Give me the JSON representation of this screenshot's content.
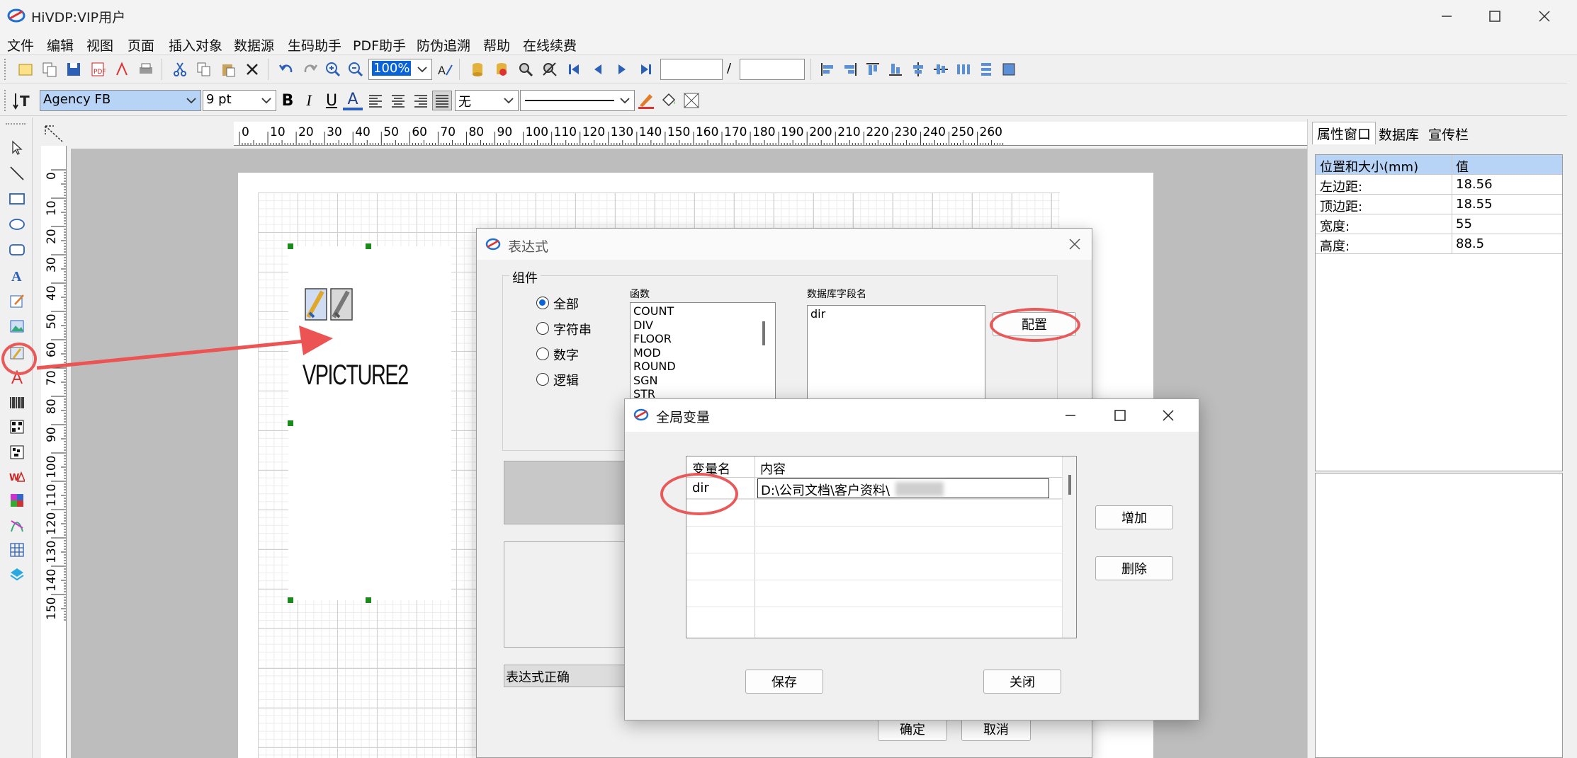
{
  "window": {
    "title": "HiVDP:VIP用户"
  },
  "menu": [
    "文件",
    "编辑",
    "视图",
    "页面",
    "插入对象",
    "数据源",
    "生码助手",
    "PDF助手",
    "防伪追溯",
    "帮助",
    "在线续费"
  ],
  "toolbar": {
    "zoom": "100%",
    "page_sep": "/"
  },
  "format_toolbar": {
    "font_name": "Agency FB",
    "font_size": "9 pt",
    "bold": "B",
    "italic": "I",
    "underline": "U",
    "font_color": "A",
    "border_style": "无"
  },
  "ruler": {
    "top": [
      "0",
      "10",
      "20",
      "30",
      "40",
      "50",
      "60",
      "70",
      "80",
      "90",
      "100",
      "110",
      "120",
      "130",
      "140",
      "150",
      "160",
      "170",
      "180",
      "190",
      "200",
      "210",
      "220",
      "230",
      "240",
      "250",
      "260"
    ],
    "left": [
      "0",
      "10",
      "20",
      "30",
      "40",
      "50",
      "60",
      "70",
      "80",
      "90",
      "100",
      "110",
      "120",
      "130",
      "140",
      "150"
    ]
  },
  "canvas": {
    "picture_label": "VPICTURE2"
  },
  "properties": {
    "tabs": [
      "属性窗口",
      "数据库",
      "宣传栏"
    ],
    "header_key": "位置和大小(mm)",
    "header_value": "值",
    "rows": [
      {
        "key": "左边距:",
        "value": "18.56"
      },
      {
        "key": "顶边距:",
        "value": "18.55"
      },
      {
        "key": "宽度:",
        "value": "55"
      },
      {
        "key": "高度:",
        "value": "88.5"
      }
    ]
  },
  "expression_dialog": {
    "title": "表达式",
    "group_label": "组件",
    "radio_options": [
      "全部",
      "字符串",
      "数字",
      "逻辑"
    ],
    "selected_radio": "全部",
    "functions_label": "函数",
    "functions": [
      "COUNT",
      "DIV",
      "FLOOR",
      "MOD",
      "ROUND",
      "SGN",
      "STR"
    ],
    "db_fields_label": "数据库字段名",
    "db_fields": [
      "dir"
    ],
    "config_button": "配置",
    "status": "表达式正确",
    "ok_button": "确定",
    "cancel_button": "取消"
  },
  "global_var_dialog": {
    "title": "全局变量",
    "col_name": "变量名",
    "col_content": "内容",
    "rows": [
      {
        "name": "dir",
        "content": "D:\\公司文档\\客户资料\\"
      }
    ],
    "add_button": "增加",
    "delete_button": "删除",
    "save_button": "保存",
    "close_button": "关闭"
  },
  "colors": {
    "annotation_red": "#e85a5a",
    "selection_blue": "#b7d3f5",
    "handle_green": "#1a8a1a",
    "canvas_gray": "#bdbdbd"
  }
}
